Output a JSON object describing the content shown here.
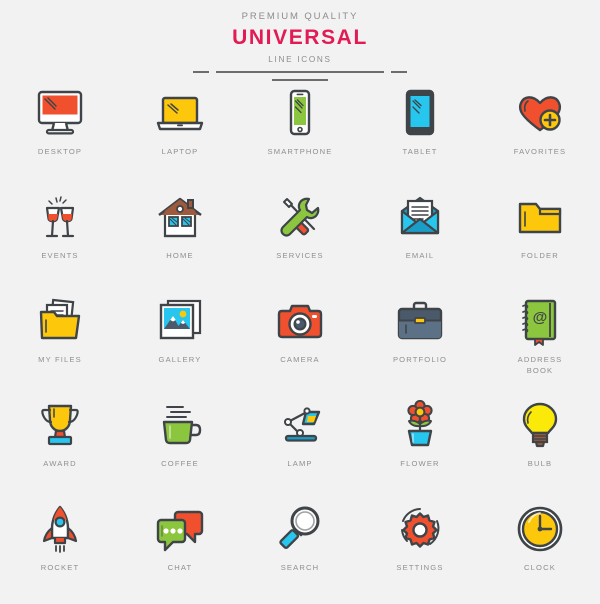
{
  "header": {
    "kicker": "PREMIUM QUALITY",
    "brand": "UNIVERSAL",
    "subkicker": "LINE ICONS",
    "brand_color": "#e31b54",
    "kicker_color": "#8c8c8c",
    "rule_color": "#6d6d6d"
  },
  "palette": {
    "background": "#f2f2f2",
    "stroke": "#3f4448",
    "orange_red": "#f1502f",
    "yellow": "#fdc70c",
    "green": "#8cc63e",
    "cyan": "#27c6ef",
    "blue": "#1b9dc9",
    "slate": "#4a5a6a",
    "brown": "#9e5a3c",
    "white": "#ffffff",
    "label": "#8f8f8f"
  },
  "icons": [
    {
      "label": "DESKTOP",
      "name": "desktop-icon"
    },
    {
      "label": "LAPTOP",
      "name": "laptop-icon"
    },
    {
      "label": "SMARTPHONE",
      "name": "smartphone-icon"
    },
    {
      "label": "TABLET",
      "name": "tablet-icon"
    },
    {
      "label": "FAVORITES",
      "name": "favorites-icon"
    },
    {
      "label": "EVENTS",
      "name": "events-icon"
    },
    {
      "label": "HOME",
      "name": "home-icon"
    },
    {
      "label": "SERVICES",
      "name": "services-icon"
    },
    {
      "label": "EMAIL",
      "name": "email-icon"
    },
    {
      "label": "FOLDER",
      "name": "folder-icon"
    },
    {
      "label": "MY FILES",
      "name": "my-files-icon"
    },
    {
      "label": "GALLERY",
      "name": "gallery-icon"
    },
    {
      "label": "CAMERA",
      "name": "camera-icon"
    },
    {
      "label": "PORTFOLIO",
      "name": "portfolio-icon"
    },
    {
      "label": "ADDRESS\nBOOK",
      "name": "address-book-icon"
    },
    {
      "label": "AWARD",
      "name": "award-icon"
    },
    {
      "label": "COFFEE",
      "name": "coffee-icon"
    },
    {
      "label": "LAMP",
      "name": "lamp-icon"
    },
    {
      "label": "FLOWER",
      "name": "flower-icon"
    },
    {
      "label": "BULB",
      "name": "bulb-icon"
    },
    {
      "label": "ROCKET",
      "name": "rocket-icon"
    },
    {
      "label": "CHAT",
      "name": "chat-icon"
    },
    {
      "label": "SEARCH",
      "name": "search-icon"
    },
    {
      "label": "SETTINGS",
      "name": "settings-icon"
    },
    {
      "label": "CLOCK",
      "name": "clock-icon"
    }
  ]
}
